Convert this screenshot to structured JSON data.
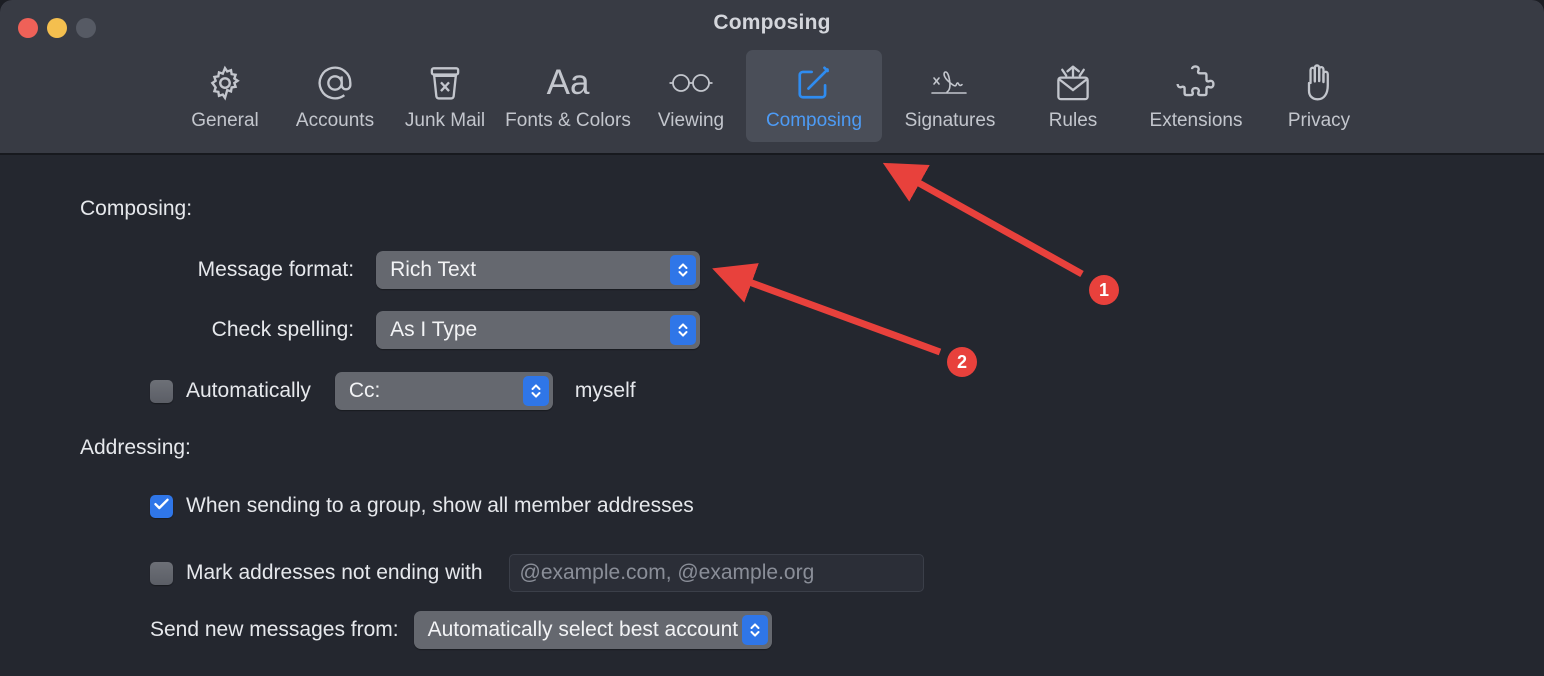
{
  "window": {
    "title": "Composing",
    "traffic_lights": [
      {
        "name": "close",
        "color": "#ef6158"
      },
      {
        "name": "minimize",
        "color": "#f4bf4f"
      },
      {
        "name": "zoom",
        "color": "#565a64"
      }
    ]
  },
  "toolbar": {
    "items": [
      {
        "label": "General",
        "icon": "gear-icon"
      },
      {
        "label": "Accounts",
        "icon": "at-sign-icon"
      },
      {
        "label": "Junk Mail",
        "icon": "trash-x-icon"
      },
      {
        "label": "Fonts & Colors",
        "icon": "aa-text-icon"
      },
      {
        "label": "Viewing",
        "icon": "eyeglasses-icon"
      },
      {
        "label": "Composing",
        "icon": "compose-pencil-icon",
        "selected": true
      },
      {
        "label": "Signatures",
        "icon": "signature-icon"
      },
      {
        "label": "Rules",
        "icon": "envelope-arrows-icon"
      },
      {
        "label": "Extensions",
        "icon": "puzzle-piece-icon"
      },
      {
        "label": "Privacy",
        "icon": "hand-icon"
      }
    ],
    "selected_color": "#4d9bf5"
  },
  "composing_section": {
    "heading": "Composing:",
    "message_format": {
      "label": "Message format:",
      "value": "Rich Text"
    },
    "check_spelling": {
      "label": "Check spelling:",
      "value": "As I Type"
    },
    "auto_cc": {
      "checkbox_label": "Automatically",
      "checked": false,
      "value": "Cc:",
      "suffix": "myself"
    }
  },
  "addressing_section": {
    "heading": "Addressing:",
    "show_group_members": {
      "label": "When sending to a group, show all member addresses",
      "checked": true
    },
    "mark_addresses": {
      "label": "Mark addresses not ending with",
      "checked": false,
      "placeholder": "@example.com, @example.org"
    },
    "send_from": {
      "label": "Send new messages from:",
      "value": "Automatically select best account"
    }
  },
  "annotations": {
    "accent_color": "#e8413c",
    "markers": [
      {
        "number": "1",
        "points_to": "Composing toolbar tab"
      },
      {
        "number": "2",
        "points_to": "Message format popup button"
      }
    ]
  }
}
